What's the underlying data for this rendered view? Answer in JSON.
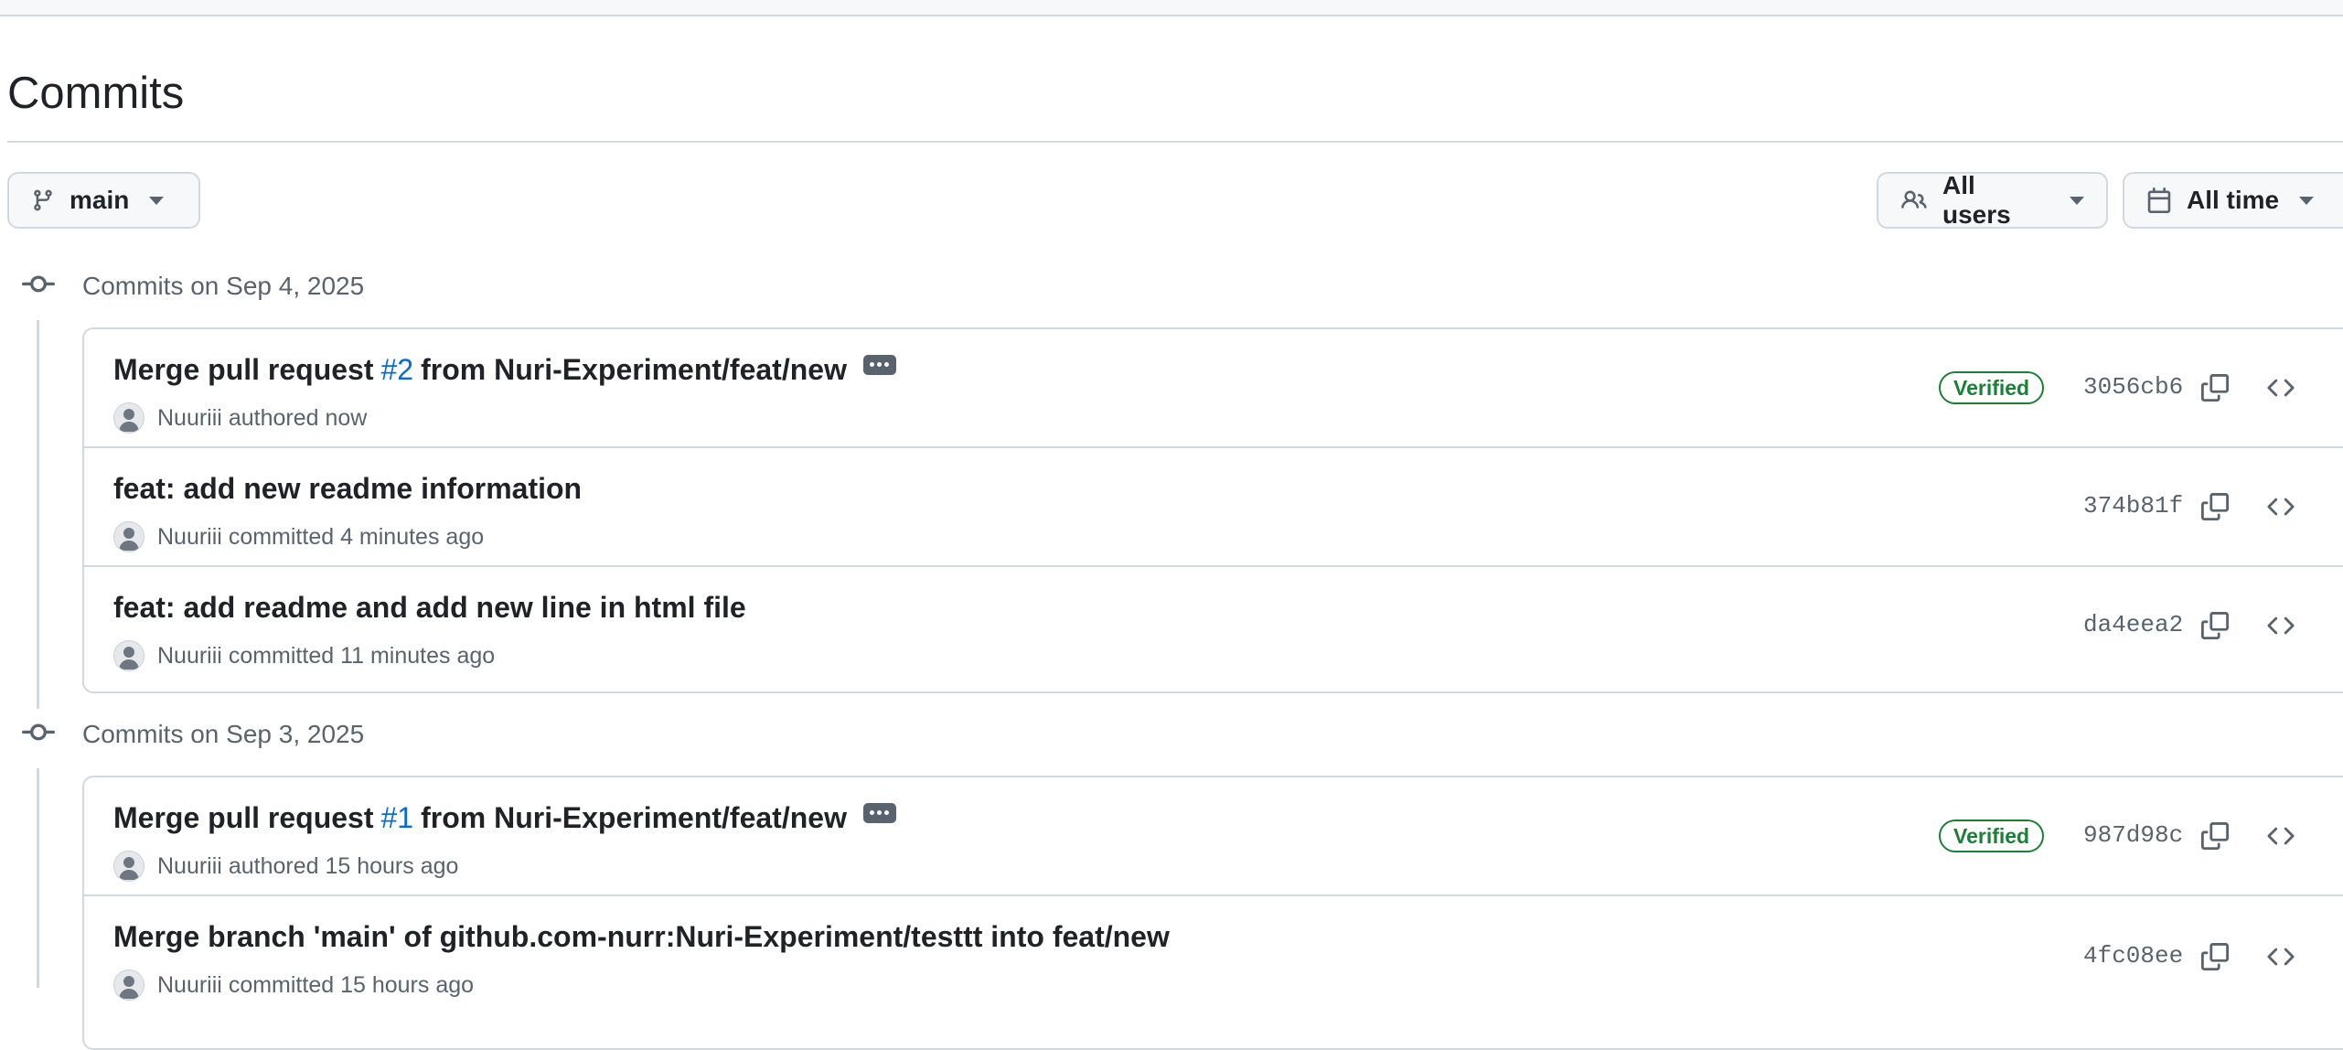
{
  "page": {
    "title": "Commits"
  },
  "filters": {
    "branch_label": "main",
    "users_label": "All users",
    "time_label": "All time"
  },
  "groups": [
    {
      "heading": "Commits on Sep 4, 2025",
      "commits": [
        {
          "msg_before": "Merge pull request",
          "msg_link": "#2",
          "msg_after": "from Nuri-Experiment/feat/new",
          "has_ellipsis": true,
          "author": "Nuuriii",
          "action": "authored",
          "time": "now",
          "verified": "Verified",
          "sha": "3056cb6"
        },
        {
          "msg_before": "feat: add new readme information",
          "author": "Nuuriii",
          "action": "committed",
          "time": "4 minutes ago",
          "sha": "374b81f"
        },
        {
          "msg_before": "feat: add readme and add new line in html file",
          "author": "Nuuriii",
          "action": "committed",
          "time": "11 minutes ago",
          "sha": "da4eea2"
        }
      ]
    },
    {
      "heading": "Commits on Sep 3, 2025",
      "commits": [
        {
          "msg_before": "Merge pull request",
          "msg_link": "#1",
          "msg_after": "from Nuri-Experiment/feat/new",
          "has_ellipsis": true,
          "author": "Nuuriii",
          "action": "authored",
          "time": "15 hours ago",
          "verified": "Verified",
          "sha": "987d98c"
        },
        {
          "msg_before": "Merge branch 'main' of github.com-nurr:Nuri-Experiment/testtt into feat/new",
          "author": "Nuuriii",
          "action": "committed",
          "time": "15 hours ago",
          "sha": "4fc08ee"
        }
      ]
    }
  ],
  "icons": {
    "branch": "git-branch-icon",
    "users": "people-icon",
    "time": "calendar-icon",
    "commit": "git-commit-icon",
    "copy": "copy-icon",
    "browse": "code-icon"
  },
  "colors": {
    "link": "#0969da",
    "verified": "#1a7f37",
    "muted": "#59636e",
    "border": "#d1d9e0"
  }
}
